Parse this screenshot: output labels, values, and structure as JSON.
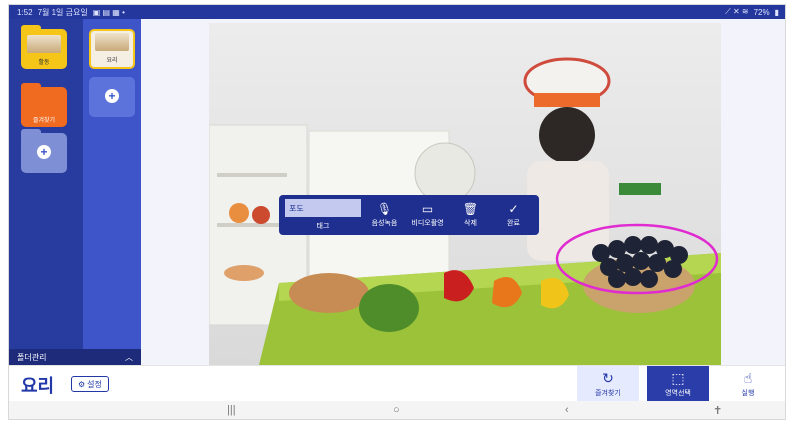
{
  "status_bar": {
    "time": "1:52",
    "date": "7월 1일 금요일",
    "right": "72%"
  },
  "sidebar": {
    "folders": [
      {
        "label": "활동"
      },
      {
        "label": "요리"
      },
      {
        "label": "즐겨찾기"
      }
    ],
    "manage_label": "폴더관리"
  },
  "toolbar": {
    "tag_value": "포도",
    "tag_label": "태그",
    "voice_label": "음성녹음",
    "video_label": "비디오촬영",
    "delete_label": "삭제",
    "done_label": "완료"
  },
  "bottom": {
    "title": "요리",
    "settings_label": "설정",
    "favorite_label": "즐겨찾기",
    "area_label": "영역선택",
    "run_label": "실행"
  },
  "colors": {
    "primary": "#24379c",
    "sidebar_light": "#3d55c9",
    "folder_yellow": "#f5c518",
    "folder_orange": "#f06a1f",
    "folder_gray": "#7f8fd6",
    "selection_outline": "#e02bd1"
  }
}
